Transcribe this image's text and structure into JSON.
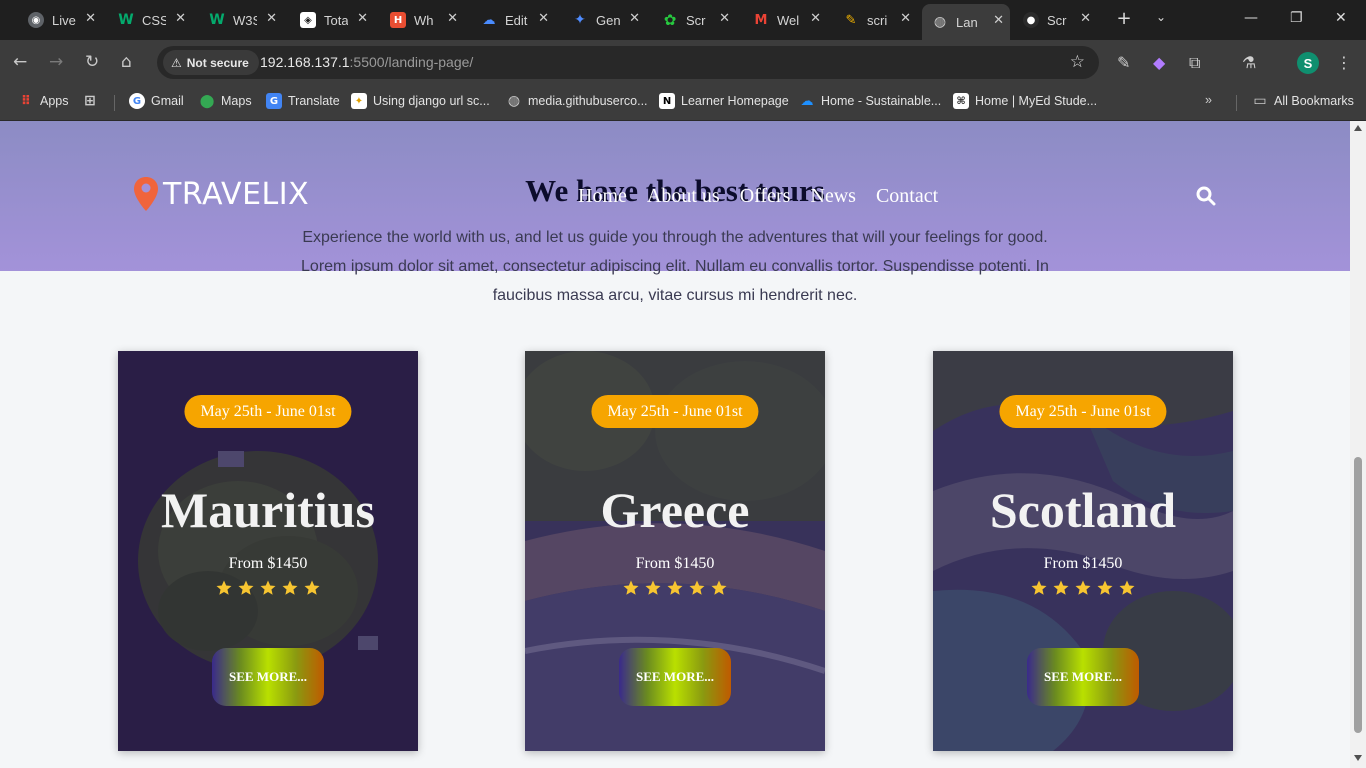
{
  "browser": {
    "tabs": [
      {
        "label": "Live",
        "icon": "live-icon",
        "color": "#9aa0a6"
      },
      {
        "label": "CSS",
        "icon": "w3schools-icon",
        "color": "#04aa6d"
      },
      {
        "label": "W3S",
        "icon": "w3schools-icon",
        "color": "#04aa6d"
      },
      {
        "label": "Tota",
        "icon": "tota-icon",
        "color": "#ffffff"
      },
      {
        "label": "Wh",
        "icon": "hackerrank-icon",
        "color": "#e94e32"
      },
      {
        "label": "Edit",
        "icon": "cloud-icon",
        "color": "#4a8cff"
      },
      {
        "label": "Gen",
        "icon": "gemini-icon",
        "color": "#4f8cff"
      },
      {
        "label": "Scr",
        "icon": "scratch-icon",
        "color": "#27c93f"
      },
      {
        "label": "Wel",
        "icon": "gmail-icon",
        "color": "#ea4335"
      },
      {
        "label": "scri",
        "icon": "script-icon",
        "color": "#f4b400"
      },
      {
        "label": "Lan",
        "icon": "globe-icon",
        "color": "#9aa0a6"
      },
      {
        "label": "Scr",
        "icon": "discord-icon",
        "color": "#5865f2"
      }
    ],
    "url": {
      "host": "192.168.137.1",
      "rest": ":5500/landing-page/"
    },
    "not_secure": "Not secure",
    "profile_initial": "S",
    "bookmarks": [
      {
        "label": "Apps",
        "icon": "apps-icon"
      },
      {
        "label": "Gmail",
        "icon": "google-icon"
      },
      {
        "label": "Maps",
        "icon": "maps-icon"
      },
      {
        "label": "Translate",
        "icon": "translate-icon"
      },
      {
        "label": "Using django url sc...",
        "icon": "bulb-icon"
      },
      {
        "label": "media.githubuserco...",
        "icon": "globe-icon"
      },
      {
        "label": "Learner Homepage",
        "icon": "notion-icon"
      },
      {
        "label": "Home - Sustainable...",
        "icon": "onedrive-icon"
      },
      {
        "label": "Home | MyEd Stude...",
        "icon": "myed-icon"
      }
    ],
    "all_bookmarks": "All Bookmarks"
  },
  "site": {
    "logo": "TRAVELIX",
    "nav": [
      "Home",
      "About us",
      "Offers",
      "News",
      "Contact"
    ],
    "section_title": "We have the best tours",
    "section_desc_1": "Experience the world with us, and let us guide you through the adventures that will your feelings for good.",
    "section_desc_2": "Lorem ipsum dolor sit amet, consectetur adipiscing elit. Nullam eu convallis tortor. Suspendisse potenti. In",
    "section_desc_3": "faucibus massa arcu, vitae cursus mi hendrerit nec.",
    "cards": [
      {
        "date": "May 25th - June 01st",
        "title": "Mauritius",
        "price": "From $1450",
        "rating": 5,
        "button": "SEE MORE..."
      },
      {
        "date": "May 25th - June 01st",
        "title": "Greece",
        "price": "From $1450",
        "rating": 5,
        "button": "SEE MORE..."
      },
      {
        "date": "May 25th - June 01st",
        "title": "Scotland",
        "price": "From $1450",
        "rating": 5,
        "button": "SEE MORE..."
      }
    ],
    "colors": {
      "accent": "#f6a500",
      "star": "#f7c531",
      "header": "#a392d9"
    }
  }
}
